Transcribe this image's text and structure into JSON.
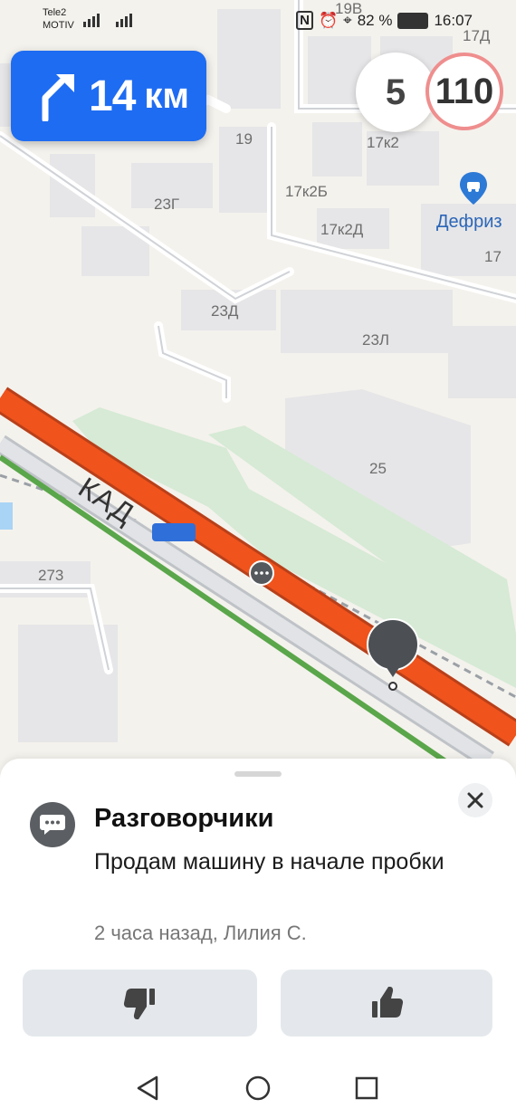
{
  "status_bar": {
    "carrier_1": "Tele2",
    "carrier_2": "MOTIV",
    "battery": "82 %",
    "time": "16:07"
  },
  "navigation": {
    "distance": "14",
    "unit": "км",
    "maneuver_icon": "turn-right-icon"
  },
  "speed": {
    "current": "5",
    "limit": "110"
  },
  "map": {
    "labels": [
      "19В",
      "17Д",
      "19",
      "17к2",
      "23Г",
      "17к2Б",
      "17к2Д",
      "17",
      "23Д",
      "23Л",
      "25",
      "273"
    ],
    "road_name": "КАД",
    "poi": {
      "name": "Дефриз",
      "icon": "car-service-icon"
    },
    "colors": {
      "road_jam": "#f0531c",
      "road_free": "#5aa64a",
      "park": "#d6ead5"
    }
  },
  "sheet": {
    "title": "Разговорчики",
    "message": "Продам машину в начале пробки",
    "meta": "2 часа назад, Лилия С.",
    "dislike_icon": "thumb-down-icon",
    "like_icon": "thumb-up-icon",
    "close_icon": "close-icon"
  },
  "system_nav": {
    "back_icon": "back-triangle-icon",
    "home_icon": "home-circle-icon",
    "recents_icon": "recents-square-icon"
  }
}
